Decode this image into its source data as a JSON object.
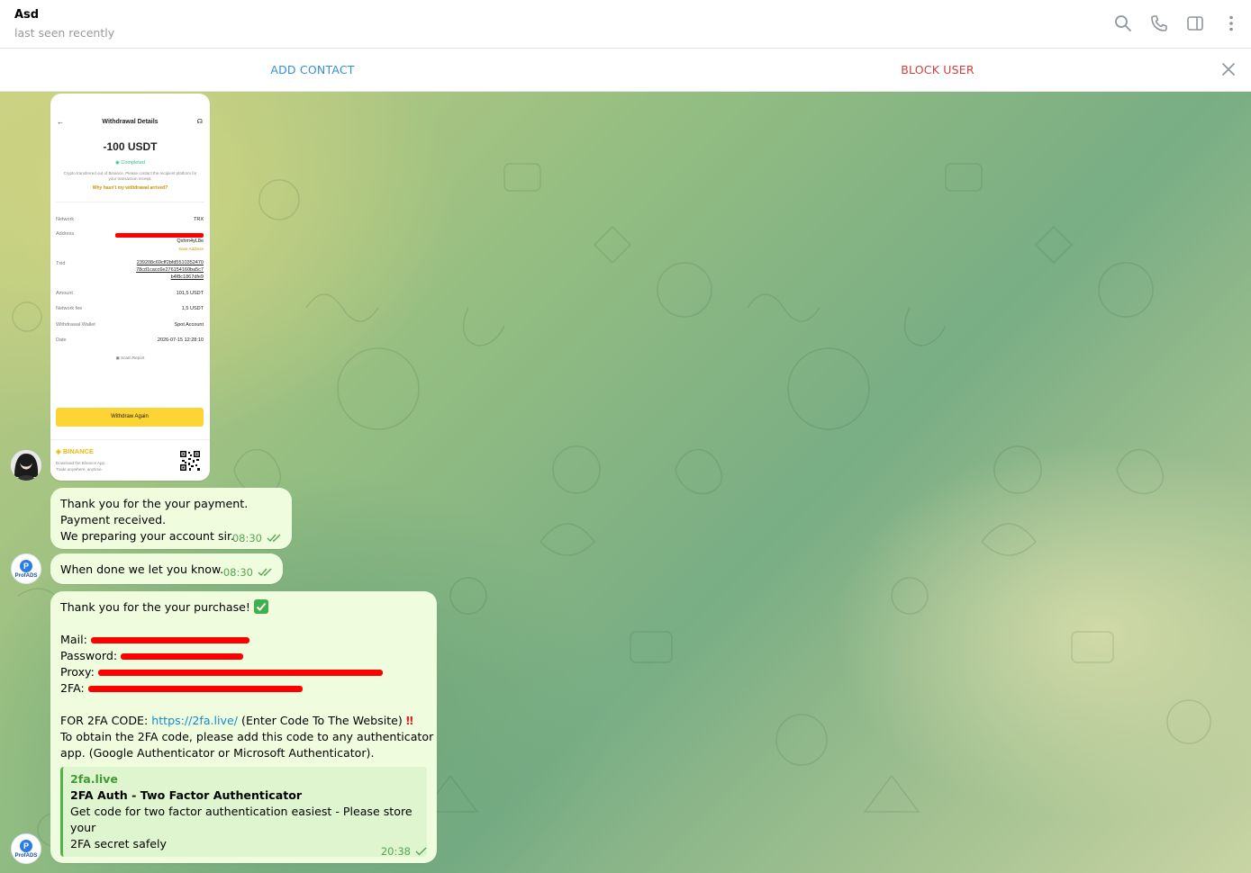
{
  "header": {
    "title": "Asd",
    "status": "last seen recently",
    "icons": [
      "search-icon",
      "phone-icon",
      "sidebar-icon",
      "more-icon"
    ]
  },
  "actionbar": {
    "add_contact": "ADD CONTACT",
    "block_user": "BLOCK USER"
  },
  "receipt": {
    "title": "Withdrawal Details",
    "amount": "-100 USDT",
    "status": "Completed",
    "description": "Crypto transferred out of Binance. Please contact the recipient platform for your transaction receipt.",
    "help_link": "Why hasn't my withdrawal arrived?",
    "network_label": "Network",
    "network_value": "TRX",
    "address_label": "Address",
    "address_value": "Qxhm4yL8e",
    "save_address": "Save Address",
    "txid_label": "Txid",
    "txid_line1": "239208c69cff2bfd5510352470",
    "txid_line2": "78cd1cacc6e276154160ba5c7",
    "txid_line3": "b4f8c1867dfe9",
    "amount_label": "Amount",
    "amount_value": "101,5 USDT",
    "fee_label": "Network fee",
    "fee_value": "1,5 USDT",
    "wallet_label": "Withdrawal Wallet",
    "wallet_value": "Spot Account",
    "date_label": "Date",
    "date_value": "2026-07-15 12:28:10",
    "scam_report": "Scam Report",
    "withdraw_again": "Withdraw Again",
    "brand": "BINANCE",
    "brand_line1": "Download the Binance App.",
    "brand_line2": "Trade anywhere, anytime."
  },
  "messages": {
    "m1_line1": "Thank you for the your payment.",
    "m1_line2": "Payment received.",
    "m1_line3": "We preparing your account sir.",
    "m1_time": "08:30",
    "m2_text": "When done we let you know.",
    "m2_time": "08:30",
    "m3_line1": "Thank you for the your purchase!",
    "m3_mail": "Mail:",
    "m3_password": "Password:",
    "m3_proxy": "Proxy:",
    "m3_2fa": "2FA:",
    "m3_code_prefix": "FOR 2FA CODE:",
    "m3_code_link": "https://2fa.live/",
    "m3_code_suffix": "(Enter Code To The Website)",
    "m3_bang": "‼",
    "m3_line_obtain1": "To obtain the 2FA code, please add this code to any authenticator",
    "m3_line_obtain2": "app. (Google Authenticator or Microsoft Authenticator).",
    "preview_site": "2fa.live",
    "preview_title": "2FA Auth - Two Factor Authenticator",
    "preview_desc1": "Get code for two factor authentication easiest - Please store your",
    "preview_desc2": "2FA secret safely",
    "m3_time": "20:38"
  },
  "avatars": {
    "profads_text": "ProfADS",
    "profads_letter": "P"
  },
  "colors": {
    "accent": "#3390d6",
    "danger": "#d03f3f",
    "bubble": "#effdde",
    "time": "#56a555",
    "binance_yellow": "#fcd535"
  }
}
